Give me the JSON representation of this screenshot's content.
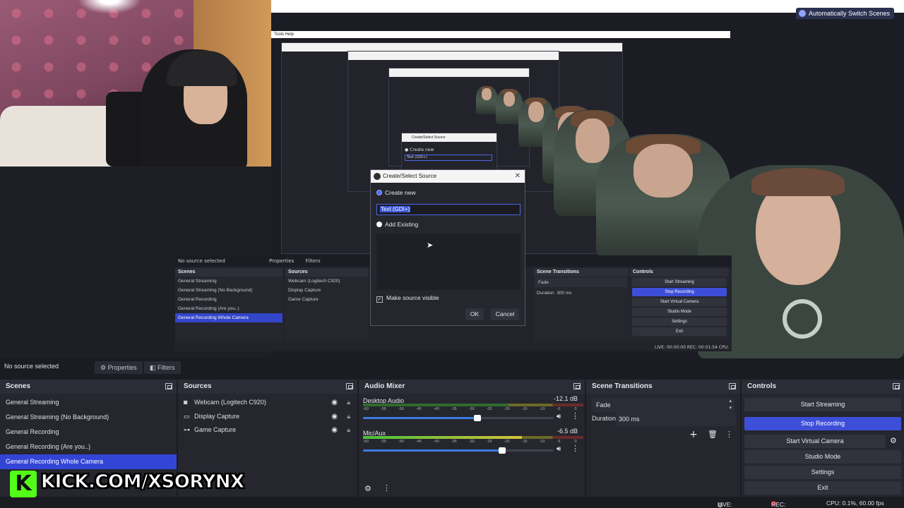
{
  "preview": {
    "auto_switch_label": "Automatically Switch Scenes",
    "inner_menu": "Tools   Help",
    "inner_no_source": "No source selected",
    "inner_properties": "Properties",
    "inner_filters": "Filters",
    "inner_scenes_title": "Scenes",
    "inner_sources_title": "Sources",
    "inner_transitions_title": "Scene Transitions",
    "inner_controls_title": "Controls",
    "inner_scenes": [
      "General Streaming",
      "General Streaming (No Background)",
      "General Recording",
      "General Recording (Are you..)",
      "General Recording Whole Camera"
    ],
    "inner_sources": [
      "Webcam (Logitech C920)",
      "Display Capture",
      "Game Capture"
    ],
    "inner_transition": "Fade",
    "inner_duration_label": "Duration",
    "inner_duration": "300 ms",
    "inner_controls": [
      "Start Streaming",
      "Stop Recording",
      "Start Virtual Camera",
      "Studio Mode",
      "Settings",
      "Exit"
    ],
    "inner_status": "LIVE: 00:00:00     REC: 00:01:54     CPU:"
  },
  "dialog": {
    "title": "Create/Select Source",
    "create_new": "Create new",
    "name_value": "Text (GDI+)",
    "add_existing": "Add Existing",
    "make_visible": "Make source visible",
    "ok": "OK",
    "cancel": "Cancel"
  },
  "toolbar": {
    "no_source": "No source selected",
    "properties": "Properties",
    "filters": "Filters"
  },
  "scenes": {
    "title": "Scenes",
    "items": [
      "General Streaming",
      "General Streaming (No Background)",
      "General Recording",
      "General Recording (Are you..)",
      "General Recording Whole Camera"
    ],
    "selected_index": 4
  },
  "sources": {
    "title": "Sources",
    "items": [
      {
        "label": "Webcam (Logitech C920)",
        "icon": "camera-icon"
      },
      {
        "label": "Display Capture",
        "icon": "monitor-icon"
      },
      {
        "label": "Game Capture",
        "icon": "gamepad-icon"
      }
    ]
  },
  "mixer": {
    "title": "Audio Mixer",
    "channels": [
      {
        "name": "Desktop Audio",
        "db": "-12.1 dB",
        "level": 0.0,
        "volume": 0.6
      },
      {
        "name": "Mic/Aux",
        "db": "-6.5 dB",
        "level": 0.72,
        "volume": 0.73
      }
    ],
    "ticks": [
      "-60",
      "-55",
      "-50",
      "-45",
      "-40",
      "-35",
      "-30",
      "-25",
      "-20",
      "-15",
      "-10",
      "-5",
      "0"
    ]
  },
  "transitions": {
    "title": "Scene Transitions",
    "selected": "Fade",
    "duration_label": "Duration",
    "duration": "300 ms"
  },
  "controls": {
    "title": "Controls",
    "start_streaming": "Start Streaming",
    "stop_recording": "Stop Recording",
    "start_virtual_camera": "Start Virtual Camera",
    "studio_mode": "Studio Mode",
    "settings": "Settings",
    "exit": "Exit"
  },
  "overlay": {
    "kick_letter": "K",
    "kick_text": "KICK.COM/XSORYNX"
  },
  "status": {
    "live": "LIVE: 00:00:00",
    "rec": "REC: 00:01:54",
    "cpu": "CPU: 0.1%, 60.00 fps"
  },
  "colors": {
    "accent": "#3345d6",
    "background": "#1b1c22",
    "panel": "#25262e",
    "kick_green": "#53fc18",
    "rec_red": "#d62a2a"
  }
}
